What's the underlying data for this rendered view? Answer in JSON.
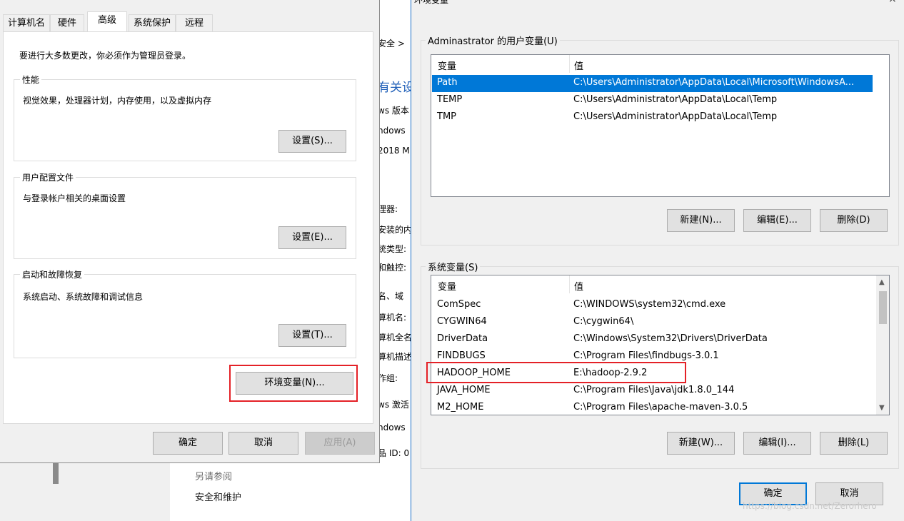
{
  "background_page": {
    "fragments": [
      "安全 >",
      "有关设",
      "ws 版本",
      "ndows",
      "2018 M",
      "理器:",
      "安装的内",
      "统类型:",
      "和触控:",
      "名、域",
      "算机名:",
      "算机全名",
      "算机描述",
      "作组:",
      "ws 激活",
      "ndows",
      "品 ID: 0"
    ],
    "see_also_label": "另请参阅",
    "security_link": "安全和维护"
  },
  "system_properties": {
    "tabs": [
      "计算机名",
      "硬件",
      "高级",
      "系统保护",
      "远程"
    ],
    "active_tab": "高级",
    "admin_notice": "要进行大多数更改，你必须作为管理员登录。",
    "performance": {
      "title": "性能",
      "desc": "视觉效果，处理器计划，内存使用，以及虚拟内存",
      "button": "设置(S)..."
    },
    "user_profiles": {
      "title": "用户配置文件",
      "desc": "与登录帐户相关的桌面设置",
      "button": "设置(E)..."
    },
    "startup_recovery": {
      "title": "启动和故障恢复",
      "desc": "系统启动、系统故障和调试信息",
      "button": "设置(T)..."
    },
    "env_vars_button": "环境变量(N)...",
    "ok_button": "确定",
    "cancel_button": "取消",
    "apply_button": "应用(A)"
  },
  "env_vars_dialog": {
    "title": "环境变量",
    "user_group_title": "Adminastrator 的用户变量(U)",
    "columns": {
      "name": "变量",
      "value": "值"
    },
    "user_vars": [
      {
        "name": "Path",
        "value": "C:\\Users\\Administrator\\AppData\\Local\\Microsoft\\WindowsA...",
        "selected": true
      },
      {
        "name": "TEMP",
        "value": "C:\\Users\\Administrator\\AppData\\Local\\Temp"
      },
      {
        "name": "TMP",
        "value": "C:\\Users\\Administrator\\AppData\\Local\\Temp"
      }
    ],
    "user_buttons": {
      "new": "新建(N)...",
      "edit": "编辑(E)...",
      "delete": "删除(D)"
    },
    "system_group_title": "系统变量(S)",
    "system_vars": [
      {
        "name": "ComSpec",
        "value": "C:\\WINDOWS\\system32\\cmd.exe"
      },
      {
        "name": "CYGWIN64",
        "value": "C:\\cygwin64\\"
      },
      {
        "name": "DriverData",
        "value": "C:\\Windows\\System32\\Drivers\\DriverData"
      },
      {
        "name": "FINDBUGS",
        "value": "C:\\Program Files\\findbugs-3.0.1"
      },
      {
        "name": "HADOOP_HOME",
        "value": "E:\\hadoop-2.9.2"
      },
      {
        "name": "JAVA_HOME",
        "value": "C:\\Program Files\\Java\\jdk1.8.0_144"
      },
      {
        "name": "M2_HOME",
        "value": "C:\\Program Files\\apache-maven-3.0.5"
      }
    ],
    "system_buttons": {
      "new": "新建(W)...",
      "edit": "编辑(I)...",
      "delete": "删除(L)"
    },
    "ok_button": "确定",
    "cancel_button": "取消",
    "close_glyph": "×"
  },
  "watermark": "https://blog.csdn.net/Zerorhero",
  "colors": {
    "selection": "#0078d7",
    "highlight_box": "#e42127",
    "dialog_bg": "#f0f0f0"
  }
}
